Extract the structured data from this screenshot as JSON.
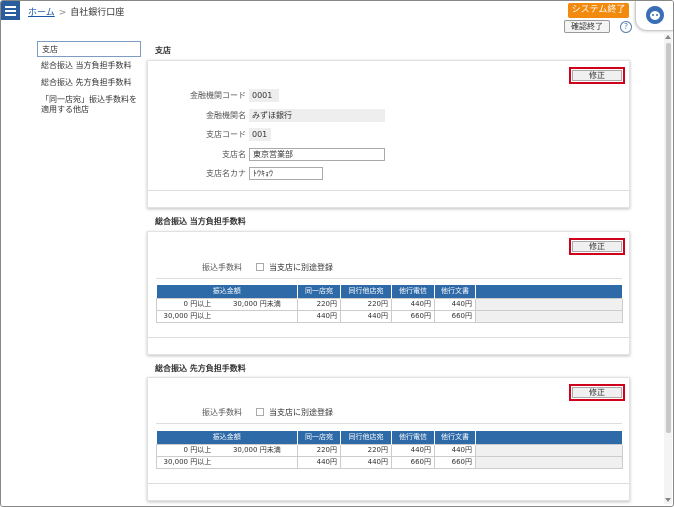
{
  "header": {
    "home": "ホーム",
    "separator": ">",
    "current": "自社銀行口座",
    "system_end": "システム終了",
    "confirm_end": "確認終了",
    "help": "?"
  },
  "nav": {
    "items": [
      {
        "label": "支店"
      },
      {
        "label": "総合振込 当方負担手数料"
      },
      {
        "label": "総合振込 先方負担手数料"
      },
      {
        "label": "「同一店宛」振込手数料を適用する他店"
      }
    ]
  },
  "branch": {
    "title": "支店",
    "edit": "修正",
    "fields": [
      {
        "label": "金融機関コード",
        "value": "0001"
      },
      {
        "label": "金融機関名",
        "value": "みずほ銀行"
      },
      {
        "label": "支店コード",
        "value": "001"
      },
      {
        "label": "支店名",
        "value": "東京営業部"
      },
      {
        "label": "支店名カナ",
        "value": "ﾄｳｷｮｳ"
      }
    ]
  },
  "fee_payer": {
    "title": "総合振込 当方負担手数料",
    "edit": "修正",
    "fee_label": "振込手数料",
    "checkbox_label": "当支店に別途登録",
    "headers": [
      "振込金額",
      "同一店宛",
      "同行他店宛",
      "他行電信",
      "他行文書"
    ],
    "rows": [
      {
        "from": "0",
        "from_unit": "円以上",
        "to": "30,000",
        "to_unit": "円未満",
        "fees": [
          "220円",
          "220円",
          "440円",
          "440円"
        ]
      },
      {
        "from": "30,000",
        "from_unit": "円以上",
        "to": "",
        "to_unit": "",
        "fees": [
          "440円",
          "440円",
          "660円",
          "660円"
        ]
      }
    ]
  },
  "fee_payee": {
    "title": "総合振込 先方負担手数料",
    "edit": "修正",
    "fee_label": "振込手数料",
    "checkbox_label": "当支店に別途登録",
    "headers": [
      "振込金額",
      "同一店宛",
      "同行他店宛",
      "他行電信",
      "他行文書"
    ],
    "rows": [
      {
        "from": "0",
        "from_unit": "円以上",
        "to": "30,000",
        "to_unit": "円未満",
        "fees": [
          "220円",
          "220円",
          "440円",
          "440円"
        ]
      },
      {
        "from": "30,000",
        "from_unit": "円以上",
        "to": "",
        "to_unit": "",
        "fees": [
          "440円",
          "440円",
          "660円",
          "660円"
        ]
      }
    ]
  },
  "colors": {
    "accent": "#2f6aa8",
    "system_end": "#f28a0e",
    "edit_highlight": "#d0021b"
  },
  "icons": {
    "menu": "hamburger-icon",
    "help": "question-icon",
    "user": "avatar-icon"
  }
}
